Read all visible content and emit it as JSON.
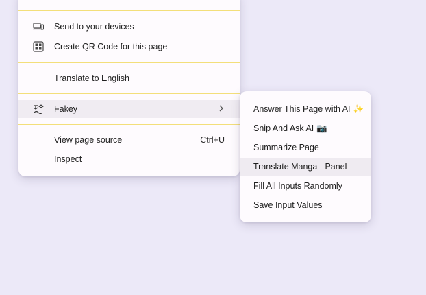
{
  "main_menu": {
    "items": [
      {
        "label": "Send to your devices",
        "icon": "devices-icon"
      },
      {
        "label": "Create QR Code for this page",
        "icon": "qr-code-icon"
      },
      {
        "label": "Translate to English"
      },
      {
        "label": "Fakey",
        "icon": "fakey-extension-icon",
        "has_submenu": true
      },
      {
        "label": "View page source",
        "shortcut": "Ctrl+U"
      },
      {
        "label": "Inspect"
      }
    ]
  },
  "sub_menu": {
    "items": [
      {
        "label": "Answer This Page with AI",
        "emoji": "✨"
      },
      {
        "label": "Snip And Ask AI",
        "emoji": "📷"
      },
      {
        "label": "Summarize Page"
      },
      {
        "label": "Translate Manga - Panel"
      },
      {
        "label": "Fill All Inputs Randomly"
      },
      {
        "label": "Save Input Values"
      }
    ]
  },
  "colors": {
    "separator": "#f3df7a",
    "menu_bg": "#fefbfe",
    "page_bg": "#ece9f8"
  }
}
